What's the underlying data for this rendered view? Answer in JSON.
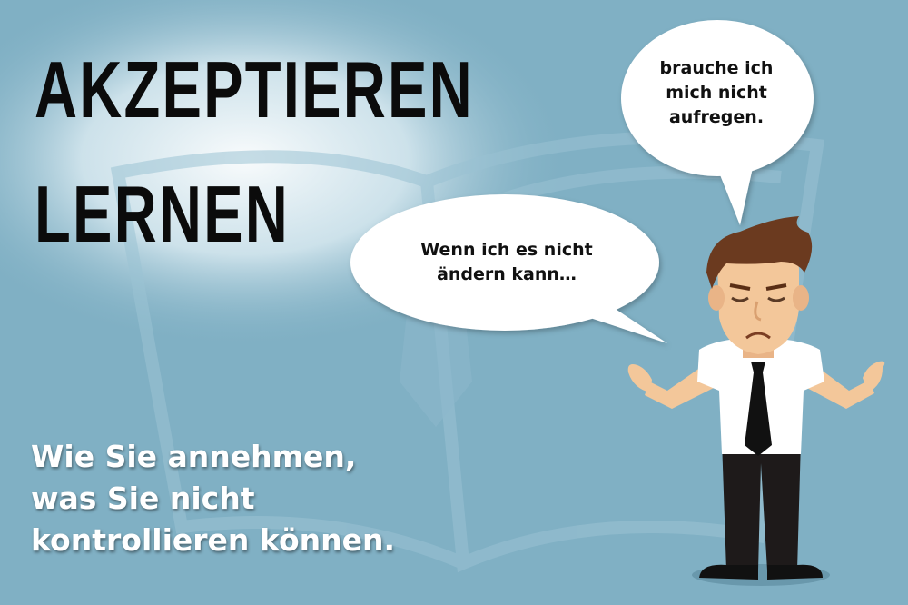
{
  "headline": {
    "line1": "AKZEPTIEREN",
    "line2": "LERNEN"
  },
  "subtitle": {
    "lines": [
      "Wie Sie annehmen,",
      "was Sie nicht",
      "kontrollieren können."
    ]
  },
  "speech_left": {
    "lines": [
      "Wenn ich es nicht",
      "ändern kann…"
    ]
  },
  "speech_right": {
    "lines": [
      "brauche ich",
      "mich nicht",
      "aufregen."
    ]
  },
  "colors": {
    "background": "#80b0c4",
    "headline": "#0b0b0b",
    "subtitle": "#ffffff",
    "bubble": "#ffffff"
  },
  "illustration": {
    "subject": "businessman-shrugging",
    "background_motif": "open-book"
  }
}
